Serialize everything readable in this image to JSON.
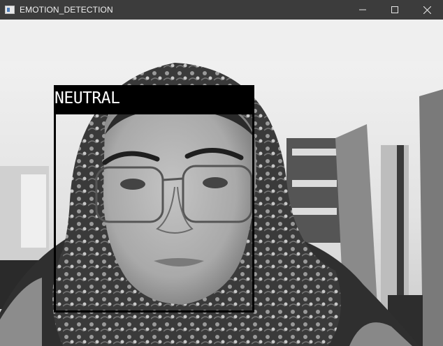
{
  "window": {
    "title": "EMOTION_DETECTION",
    "icon": "app-icon",
    "controls": [
      "minimize-icon",
      "maximize-icon",
      "close-icon"
    ]
  },
  "detection": {
    "emotion_label": "NEUTRAL",
    "box_color": "#000000",
    "label_text_color": "#ffffff"
  },
  "colors": {
    "titlebar": "#3c3c3c",
    "title_text": "#f0f0f0"
  }
}
